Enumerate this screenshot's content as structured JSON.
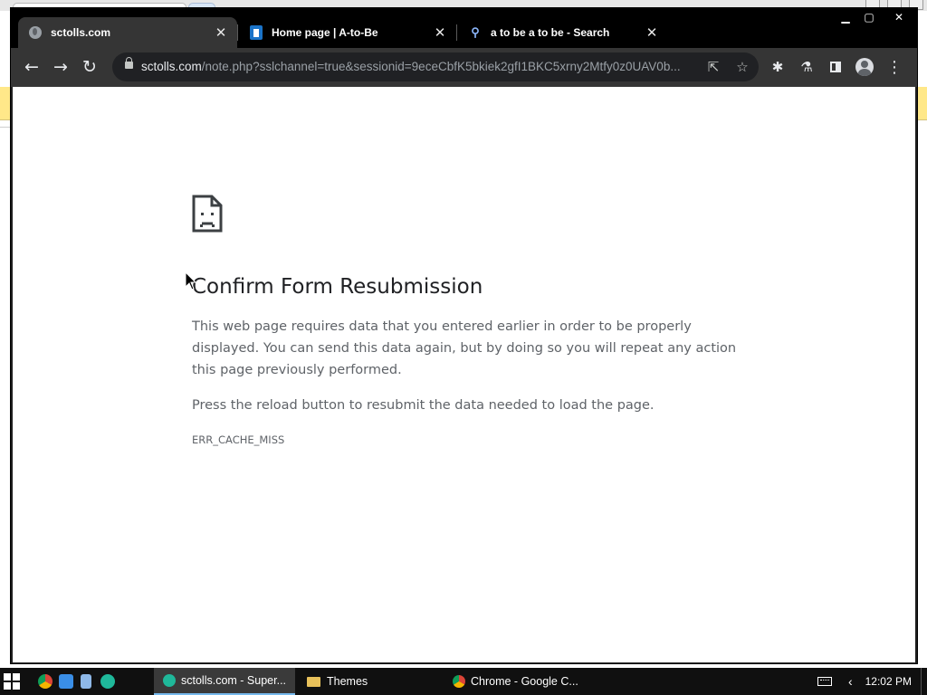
{
  "browser": {
    "tabs": [
      {
        "title": "sctolls.com",
        "icon": "globe-icon",
        "active": true
      },
      {
        "title": "Home page | A-to-Be",
        "icon": "atobe-favicon",
        "active": false
      },
      {
        "title": "a to be a to be - Search",
        "icon": "search-icon",
        "active": false
      }
    ],
    "close_glyph": "✕",
    "window_controls": {
      "minimize": "▁",
      "maximize": "▢",
      "close": "✕"
    },
    "nav": {
      "back": "←",
      "forward": "→",
      "reload": "↻"
    },
    "address": {
      "host": "sctolls.com",
      "path": "/note.php?sslchannel=true&sessionid=9eceCbfK5bkiek2gfI1BKC5xrny2Mtfy0z0UAV0b..."
    },
    "icons": {
      "share": "⇱",
      "bookmark": "☆",
      "extensions": "✱",
      "labs": "⚗",
      "menu": "⋮"
    }
  },
  "error_page": {
    "title": "Confirm Form Resubmission",
    "body": "This web page requires data that you entered earlier in order to be properly displayed. You can send this data again, but by doing so you will repeat any action this page previously performed.",
    "hint": "Press the reload button to resubmit the data needed to load the page.",
    "code": "ERR_CACHE_MISS"
  },
  "taskbar": {
    "tasks": [
      {
        "label": "sctolls.com - Super...",
        "active": true
      },
      {
        "label": "Themes",
        "active": false
      },
      {
        "label": "Chrome - Google C...",
        "active": false
      }
    ],
    "tray_chevron": "‹",
    "clock": "12:02 PM"
  },
  "colors": {
    "tabstrip": "#000000",
    "toolbar": "#353535",
    "omnibox": "#202124",
    "title_text": "#202124",
    "body_text": "#5f6368",
    "taskbar": "#101010",
    "taskbar_accent": "#76b9ed"
  }
}
